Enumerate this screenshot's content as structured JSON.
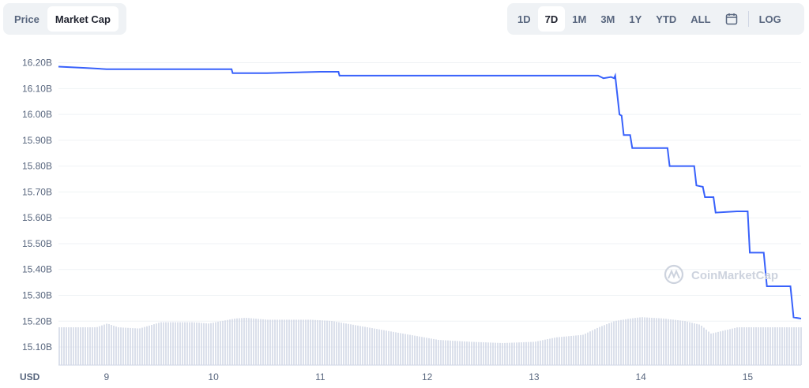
{
  "toolbar": {
    "left_tabs": [
      {
        "label": "Price",
        "active": false
      },
      {
        "label": "Market Cap",
        "active": true
      }
    ],
    "right_tabs": [
      {
        "label": "1D",
        "active": false
      },
      {
        "label": "7D",
        "active": true
      },
      {
        "label": "1M",
        "active": false
      },
      {
        "label": "3M",
        "active": false
      },
      {
        "label": "1Y",
        "active": false
      },
      {
        "label": "YTD",
        "active": false
      },
      {
        "label": "ALL",
        "active": false
      }
    ],
    "calendar_icon": "calendar-icon",
    "log_label": "LOG"
  },
  "watermark": "CoinMarketCap",
  "colors": {
    "line": "#3861fb",
    "volume": "#cfd6e4",
    "grid": "#eff2f5",
    "text": "#58667e"
  },
  "chart_data": {
    "type": "line",
    "currency_label": "USD",
    "x_ticks": [
      "9",
      "10",
      "11",
      "12",
      "13",
      "14",
      "15"
    ],
    "y_ticks": [
      "16.20B",
      "16.10B",
      "16.00B",
      "15.90B",
      "15.80B",
      "15.70B",
      "15.60B",
      "15.50B",
      "15.40B",
      "15.30B",
      "15.20B",
      "15.10B"
    ],
    "ylim": [
      15.03,
      16.22
    ],
    "xlim": [
      8.55,
      15.5
    ],
    "grid": true,
    "series": [
      {
        "values_in_billions": true,
        "x": [
          8.55,
          8.8,
          9.0,
          9.5,
          10.0,
          10.17,
          10.18,
          10.5,
          11.0,
          11.17,
          11.18,
          11.5,
          12.0,
          12.5,
          13.0,
          13.3,
          13.5,
          13.6,
          13.65,
          13.72,
          13.75,
          13.76,
          13.8,
          13.82,
          13.84,
          13.9,
          13.92,
          14.0,
          14.1,
          14.25,
          14.27,
          14.5,
          14.52,
          14.58,
          14.6,
          14.68,
          14.7,
          14.9,
          15.0,
          15.02,
          15.15,
          15.18,
          15.2,
          15.4,
          15.43,
          15.5
        ],
        "y": [
          16.185,
          16.18,
          16.175,
          16.175,
          16.175,
          16.175,
          16.16,
          16.16,
          16.165,
          16.165,
          16.15,
          16.15,
          16.15,
          16.15,
          16.15,
          16.15,
          16.15,
          16.15,
          16.14,
          16.145,
          16.14,
          16.15,
          16.0,
          15.995,
          15.92,
          15.92,
          15.87,
          15.87,
          15.87,
          15.87,
          15.8,
          15.8,
          15.725,
          15.72,
          15.68,
          15.68,
          15.62,
          15.625,
          15.625,
          15.465,
          15.465,
          15.335,
          15.335,
          15.335,
          15.215,
          15.21
        ]
      }
    ],
    "volume_profile": {
      "x": [
        8.55,
        8.9,
        9.0,
        9.1,
        9.3,
        9.5,
        9.8,
        9.95,
        10.2,
        10.3,
        10.5,
        10.9,
        11.1,
        11.3,
        11.5,
        11.7,
        11.9,
        12.1,
        12.4,
        12.7,
        13.0,
        13.2,
        13.45,
        13.6,
        13.75,
        13.9,
        14.0,
        14.2,
        14.4,
        14.55,
        14.65,
        14.75,
        14.9,
        15.0,
        15.5
      ],
      "relative_height": [
        0.6,
        0.6,
        0.66,
        0.6,
        0.58,
        0.68,
        0.68,
        0.66,
        0.74,
        0.75,
        0.72,
        0.72,
        0.7,
        0.64,
        0.58,
        0.52,
        0.46,
        0.4,
        0.37,
        0.35,
        0.37,
        0.44,
        0.48,
        0.6,
        0.7,
        0.74,
        0.76,
        0.74,
        0.7,
        0.64,
        0.5,
        0.54,
        0.6,
        0.6,
        0.6
      ]
    }
  }
}
